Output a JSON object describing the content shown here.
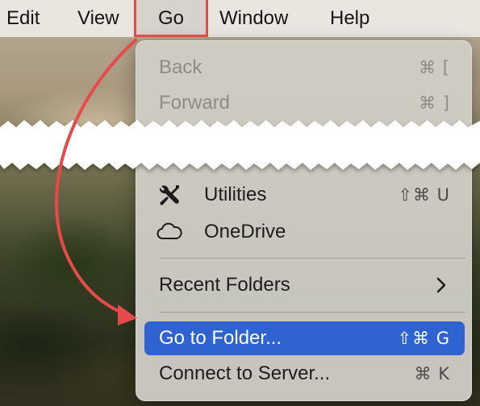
{
  "menubar": {
    "edit": "Edit",
    "view": "View",
    "go": "Go",
    "window": "Window",
    "help": "Help"
  },
  "menu": {
    "back": {
      "label": "Back",
      "shortcut": "⌘ ["
    },
    "forward": {
      "label": "Forward",
      "shortcut": "⌘ ]"
    },
    "utilities": {
      "label": "Utilities",
      "shortcut": "⇧⌘ U",
      "icon": "tools-icon"
    },
    "onedrive": {
      "label": "OneDrive",
      "shortcut": "",
      "icon": "cloud-icon"
    },
    "recent": {
      "label": "Recent Folders",
      "icon": "chevron-right-icon"
    },
    "goto": {
      "label": "Go to Folder...",
      "shortcut": "⇧⌘ G"
    },
    "connect": {
      "label": "Connect to Server...",
      "shortcut": "⌘ K"
    }
  },
  "colors": {
    "highlight": "#2e63d1",
    "annotation": "#e8494b",
    "menubar": "#e9e6e0"
  }
}
